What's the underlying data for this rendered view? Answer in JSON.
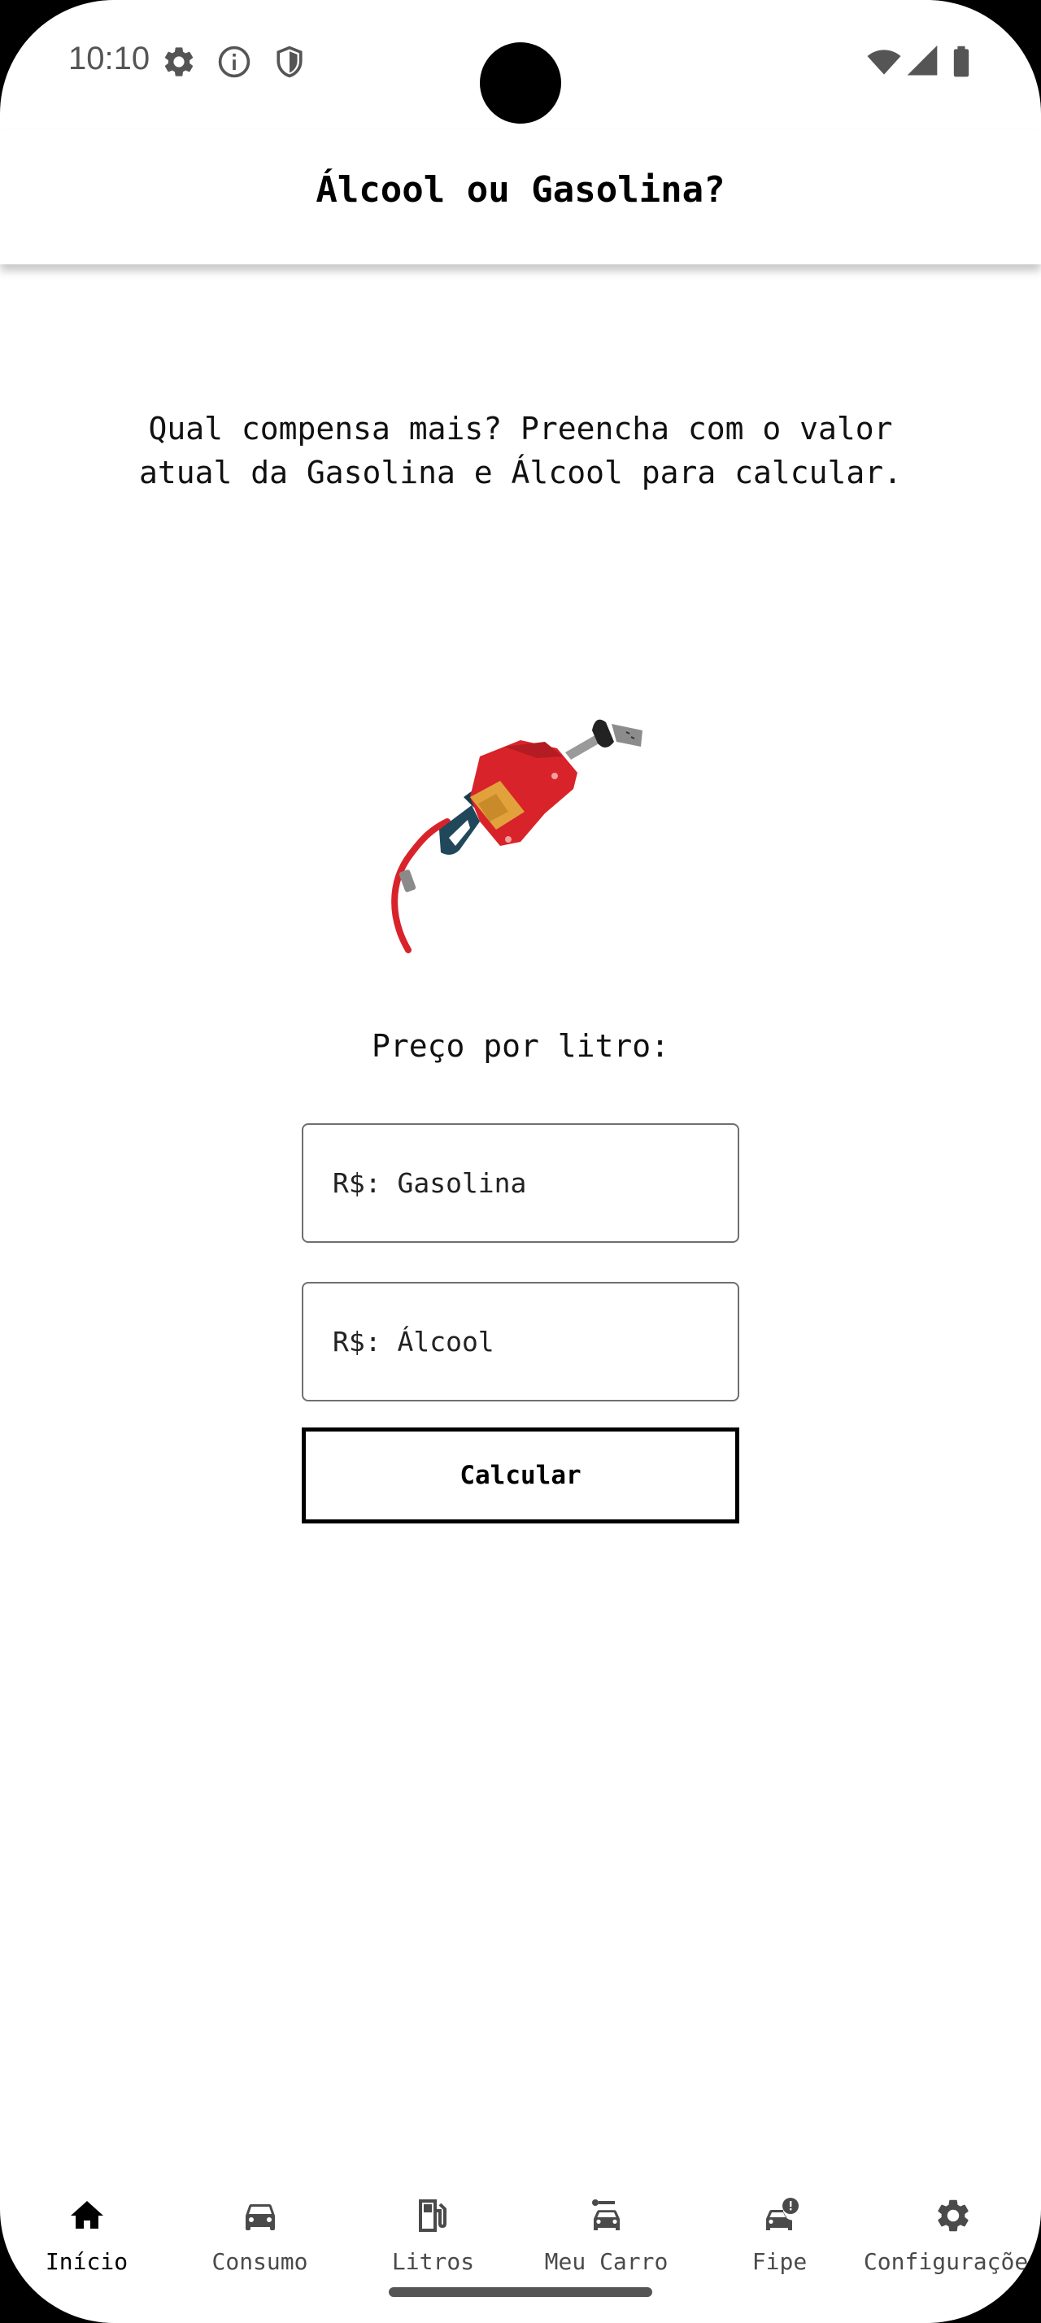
{
  "status_bar": {
    "time": "10:10",
    "icons_left": [
      "settings-gear-icon",
      "info-icon",
      "shield-icon"
    ],
    "icons_right": [
      "wifi-icon",
      "cellular-signal-icon",
      "battery-icon"
    ]
  },
  "app_bar": {
    "title": "Álcool ou Gasolina?"
  },
  "main": {
    "intro": "Qual compensa mais? Preencha com o valor atual da Gasolina e Álcool para calcular.",
    "illustration": "fuel-pump-nozzle-illustration",
    "price_label": "Preço por litro:",
    "gasolina_input": {
      "placeholder": "R$: Gasolina",
      "value": ""
    },
    "alcool_input": {
      "placeholder": "R$: Álcool",
      "value": ""
    },
    "calculate_button": "Calcular"
  },
  "bottom_nav": {
    "active_index": 0,
    "items": [
      {
        "label": "Início",
        "icon": "home-icon"
      },
      {
        "label": "Consumo",
        "icon": "car-icon"
      },
      {
        "label": "Litros",
        "icon": "fuel-station-icon"
      },
      {
        "label": "Meu Carro",
        "icon": "car-route-icon"
      },
      {
        "label": "Fipe",
        "icon": "car-alert-icon"
      },
      {
        "label": "Configurações",
        "icon": "settings-icon"
      }
    ]
  },
  "colors": {
    "background": "#ffffff",
    "text": "#111111",
    "nozzle_red": "#d9232a",
    "nozzle_orange": "#e2a23b",
    "hose_teal": "#20485a"
  }
}
